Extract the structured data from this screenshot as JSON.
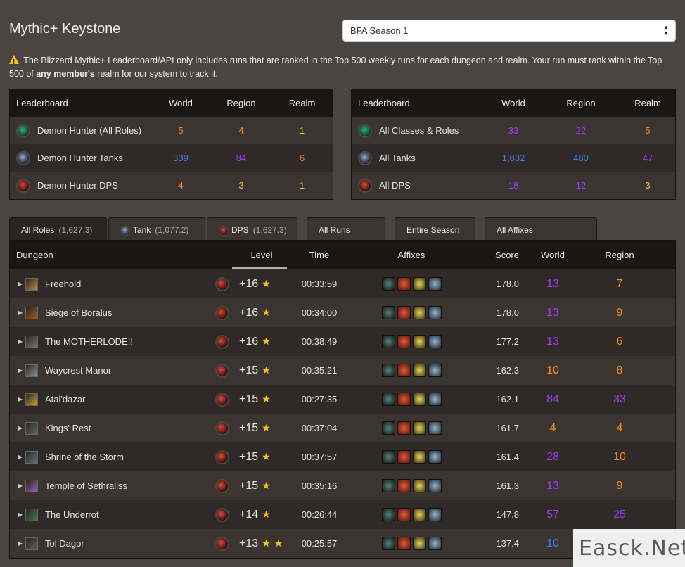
{
  "header": {
    "title": "Mythic+ Keystone",
    "season_select": "BFA Season 1"
  },
  "notice": {
    "text_1": "The Blizzard Mythic+ Leaderboard/API only includes runs that are ranked in the Top 500 weekly runs for each dungeon and realm. Your run must rank within the Top 500 of ",
    "bold": "any member's",
    "text_2": " realm for our system to track it."
  },
  "leaderboards": [
    {
      "headers": [
        "Leaderboard",
        "World",
        "Region",
        "Realm"
      ],
      "rows": [
        {
          "icon": "all-roles-icon",
          "name": "Demon Hunter (All Roles)",
          "world": "5",
          "region": "4",
          "realm": "1",
          "colors": [
            "orange",
            "orange",
            "gold"
          ]
        },
        {
          "icon": "tank-icon",
          "name": "Demon Hunter Tanks",
          "world": "339",
          "region": "84",
          "realm": "6",
          "colors": [
            "blue",
            "purple",
            "orange"
          ]
        },
        {
          "icon": "dps-icon",
          "name": "Demon Hunter DPS",
          "world": "4",
          "region": "3",
          "realm": "1",
          "colors": [
            "orange",
            "gold",
            "gold"
          ]
        }
      ]
    },
    {
      "headers": [
        "Leaderboard",
        "World",
        "Region",
        "Realm"
      ],
      "rows": [
        {
          "icon": "all-roles-icon",
          "name": "All Classes & Roles",
          "world": "33",
          "region": "22",
          "realm": "5",
          "colors": [
            "purple",
            "purple",
            "orange"
          ]
        },
        {
          "icon": "tank-icon",
          "name": "All Tanks",
          "world": "1,832",
          "region": "480",
          "realm": "47",
          "colors": [
            "blue",
            "blue",
            "purple"
          ]
        },
        {
          "icon": "dps-icon",
          "name": "All DPS",
          "world": "18",
          "region": "12",
          "realm": "3",
          "colors": [
            "purple",
            "purple",
            "gold"
          ]
        }
      ]
    }
  ],
  "tabs": [
    {
      "label": "All Roles",
      "score": "(1,627.3)",
      "active": true
    },
    {
      "label": "Tank",
      "score": "(1,077.2)",
      "active": false
    },
    {
      "label": "DPS",
      "score": "(1,627.3)",
      "active": false
    },
    {
      "label": "All Runs",
      "score": "",
      "active": false
    },
    {
      "label": "Entire Season",
      "score": "",
      "active": false
    },
    {
      "label": "All Affixes",
      "score": "",
      "active": false
    }
  ],
  "runs": {
    "headers": {
      "dungeon": "Dungeon",
      "level": "Level",
      "time": "Time",
      "affixes": "Affixes",
      "score": "Score",
      "world": "World",
      "region": "Region"
    },
    "rows": [
      {
        "dungeon": "Freehold",
        "level": "+16",
        "stars": 1,
        "time": "00:33:59",
        "score": "178.0",
        "world": "13",
        "region": "7",
        "wc": "purple",
        "rc": "orange",
        "dc": "#b68a3c"
      },
      {
        "dungeon": "Siege of Boralus",
        "level": "+16",
        "stars": 1,
        "time": "00:34:00",
        "score": "178.0",
        "world": "13",
        "region": "9",
        "wc": "purple",
        "rc": "orange",
        "dc": "#a5581e"
      },
      {
        "dungeon": "The MOTHERLODE!!",
        "level": "+16",
        "stars": 1,
        "time": "00:38:49",
        "score": "177.2",
        "world": "13",
        "region": "6",
        "wc": "purple",
        "rc": "orange",
        "dc": "#7a7570"
      },
      {
        "dungeon": "Waycrest Manor",
        "level": "+15",
        "stars": 1,
        "time": "00:35:21",
        "score": "162.3",
        "world": "10",
        "region": "8",
        "wc": "orange",
        "rc": "orange",
        "dc": "#8a95a5"
      },
      {
        "dungeon": "Atal'dazar",
        "level": "+15",
        "stars": 1,
        "time": "00:27:35",
        "score": "162.1",
        "world": "84",
        "region": "33",
        "wc": "purple",
        "rc": "purple",
        "dc": "#c5a83a"
      },
      {
        "dungeon": "Kings' Rest",
        "level": "+15",
        "stars": 1,
        "time": "00:37:04",
        "score": "161.7",
        "world": "4",
        "region": "4",
        "wc": "orange",
        "rc": "orange",
        "dc": "#4f6e5c"
      },
      {
        "dungeon": "Shrine of the Storm",
        "level": "+15",
        "stars": 1,
        "time": "00:37:57",
        "score": "161.4",
        "world": "28",
        "region": "10",
        "wc": "purple",
        "rc": "orange",
        "dc": "#5e7585"
      },
      {
        "dungeon": "Temple of Sethraliss",
        "level": "+15",
        "stars": 1,
        "time": "00:35:16",
        "score": "161.3",
        "world": "13",
        "region": "9",
        "wc": "purple",
        "rc": "orange",
        "dc": "#9a5fb0"
      },
      {
        "dungeon": "The Underrot",
        "level": "+14",
        "stars": 1,
        "time": "00:26:44",
        "score": "147.8",
        "world": "57",
        "region": "25",
        "wc": "purple",
        "rc": "purple",
        "dc": "#3f7a4a"
      },
      {
        "dungeon": "Tol Dagor",
        "level": "+13",
        "stars": 2,
        "time": "00:25:57",
        "score": "137.4",
        "world": "10",
        "region": "",
        "wc": "blue",
        "rc": "purple",
        "dc": "#55606d"
      }
    ]
  },
  "watermark": "Easck.Net",
  "colors": {
    "orange": "#ff8b1f",
    "purple": "#a03bf2",
    "blue": "#3b7ee8",
    "gold": "#f2c23a",
    "background": "#4a4540"
  }
}
